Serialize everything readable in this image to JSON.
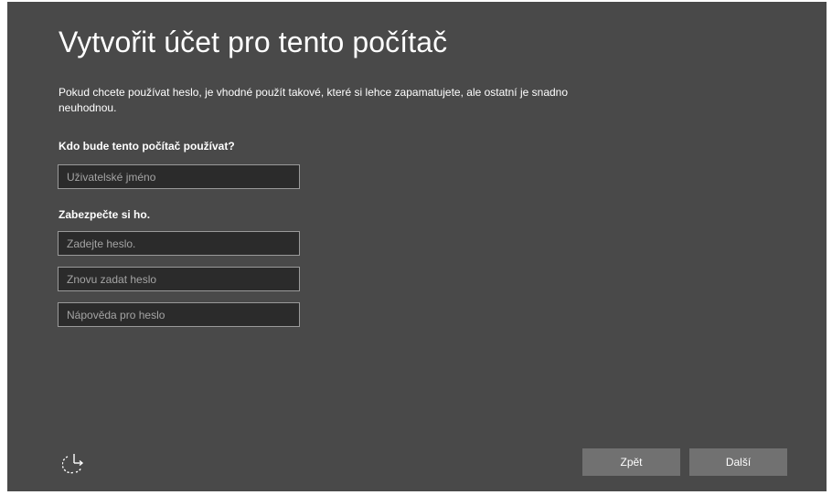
{
  "page": {
    "title": "Vytvořit účet pro tento počítač",
    "description": "Pokud chcete používat heslo, je vhodné použít takové, které si lehce zapamatujete, ale ostatní je snadno neuhodnou."
  },
  "account": {
    "user_label": "Kdo bude tento počítač používat?",
    "username_placeholder": "Uživatelské jméno",
    "username_value": ""
  },
  "security": {
    "label": "Zabezpečte si ho.",
    "password_placeholder": "Zadejte heslo.",
    "password_value": "",
    "confirm_placeholder": "Znovu zadat heslo",
    "confirm_value": "",
    "hint_placeholder": "Nápověda pro heslo",
    "hint_value": ""
  },
  "footer": {
    "accessibility_icon": "ease-of-access-icon",
    "back_label": "Zpět",
    "next_label": "Další"
  },
  "colors": {
    "background": "#494949",
    "field_background": "#2b2b2b",
    "field_border": "#9a9a9a",
    "button_background": "#717171",
    "text": "#ffffff"
  }
}
